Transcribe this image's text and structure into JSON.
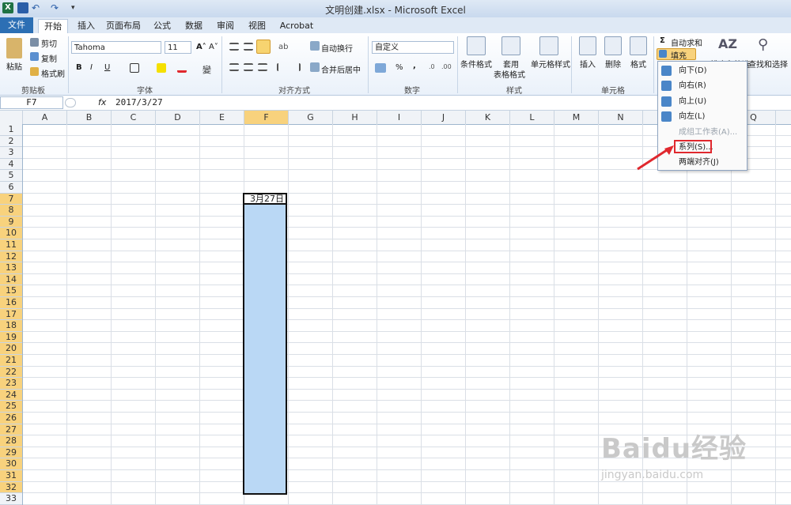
{
  "window": {
    "title": "文明创建.xlsx - Microsoft Excel"
  },
  "tabs": [
    "文件",
    "开始",
    "插入",
    "页面布局",
    "公式",
    "数据",
    "审阅",
    "视图",
    "Acrobat"
  ],
  "clipboard": {
    "paste": "粘贴",
    "cut": "剪切",
    "copy": "复制",
    "format_painter": "格式刷",
    "group": "剪贴板"
  },
  "font": {
    "name": "Tahoma",
    "size": "11",
    "group": "字体",
    "bold": "B",
    "italic": "I",
    "underline": "U",
    "grow": "A˄",
    "shrink": "A˅"
  },
  "alignment": {
    "wrap": "自动换行",
    "merge": "合并后居中",
    "group": "对齐方式"
  },
  "number": {
    "format": "自定义",
    "group": "数字",
    "percent": "%",
    "comma": ","
  },
  "styles": {
    "conditional": "条件格式",
    "table_1": "套用",
    "table_2": "表格格式",
    "cell_styles": "单元格样式",
    "group": "样式"
  },
  "cells": {
    "insert": "插入",
    "delete": "删除",
    "format": "格式",
    "group": "单元格"
  },
  "editing": {
    "autosum": "自动求和",
    "fill": "填充",
    "sort": "排序和筛选",
    "find": "查找和选择"
  },
  "formula_bar": {
    "name_box": "F7",
    "fx": "fx",
    "value": "2017/3/27"
  },
  "columns": [
    "A",
    "B",
    "C",
    "D",
    "E",
    "F",
    "G",
    "H",
    "I",
    "J",
    "K",
    "L",
    "M",
    "N",
    "O",
    "P",
    "Q"
  ],
  "selected_column": "F",
  "rows": [
    "1",
    "2",
    "3",
    "4",
    "5",
    "6",
    "7",
    "8",
    "9",
    "10",
    "11",
    "12",
    "13",
    "14",
    "15",
    "16",
    "17",
    "18",
    "19",
    "20",
    "21",
    "22",
    "23",
    "24",
    "25",
    "26",
    "27",
    "28",
    "29",
    "30",
    "31",
    "32",
    "33"
  ],
  "active_cell": {
    "ref": "F7",
    "value": "3月27日"
  },
  "fill_menu": [
    {
      "label": "向下(D)",
      "disabled": false
    },
    {
      "label": "向右(R)",
      "disabled": false
    },
    {
      "label": "向上(U)",
      "disabled": false
    },
    {
      "label": "向左(L)",
      "disabled": false
    },
    {
      "label": "成组工作表(A)...",
      "disabled": true
    },
    {
      "label": "系列(S)...",
      "disabled": false
    },
    {
      "label": "两端对齐(J)",
      "disabled": false
    }
  ],
  "colors": {
    "accent": "#2c6fb4",
    "selection": "#bad8f5",
    "header_selected": "#f8d27d",
    "highlight": "#e0282e"
  },
  "watermark": {
    "brand": "Baidu经验",
    "url": "jingyan.baidu.com"
  }
}
